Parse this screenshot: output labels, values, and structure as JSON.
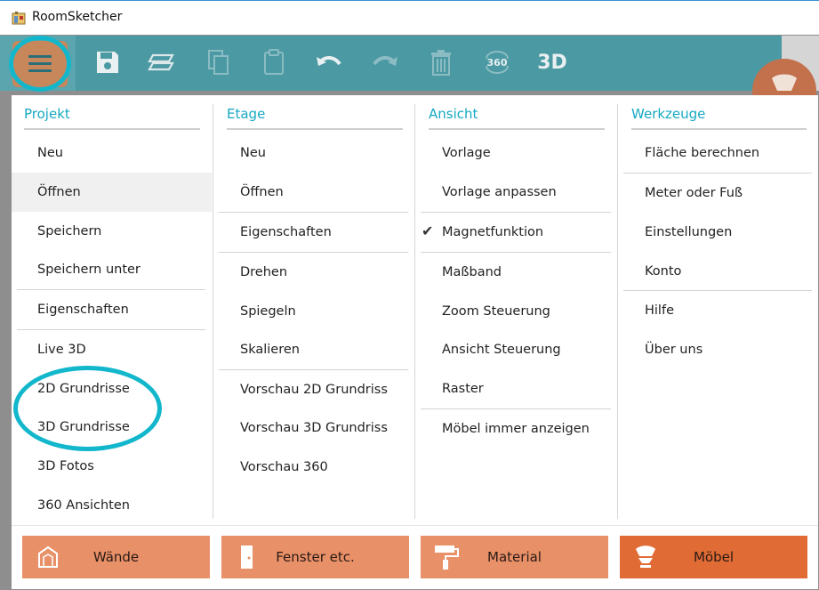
{
  "window": {
    "title": "RoomSketcher"
  },
  "toolbar": {
    "icons": [
      "menu-icon",
      "save-icon",
      "floor-layers-icon",
      "copy-icon",
      "paste-icon",
      "undo-icon",
      "redo-icon",
      "trash-icon",
      "rotate-360-icon"
    ],
    "rotate_label": "360",
    "view_3d_label": "3D"
  },
  "columns": [
    {
      "title": "Projekt",
      "items": [
        "Neu",
        "Öffnen",
        "Speichern",
        "Speichern unter",
        "Eigenschaften",
        "Live 3D",
        "2D Grundrisse",
        "3D Grundrisse",
        "3D Fotos",
        "360 Ansichten"
      ]
    },
    {
      "title": "Etage",
      "items": [
        "Neu",
        "Öffnen",
        "Eigenschaften",
        "Drehen",
        "Spiegeln",
        "Skalieren",
        "Vorschau 2D Grundriss",
        "Vorschau 3D Grundriss",
        "Vorschau 360"
      ]
    },
    {
      "title": "Ansicht",
      "items": [
        "Vorlage",
        "Vorlage anpassen",
        "Magnetfunktion",
        "Maßband",
        "Zoom Steuerung",
        "Ansicht Steuerung",
        "Raster",
        "Möbel immer anzeigen"
      ]
    },
    {
      "title": "Werkzeuge",
      "items": [
        "Fläche berechnen",
        "Meter oder Fuß",
        "Einstellungen",
        "Konto",
        "Hilfe",
        "Über uns"
      ]
    }
  ],
  "checked": {
    "item": "Magnetfunktion",
    "mark": "✔"
  },
  "bottom_buttons": [
    {
      "label": "Wände",
      "icon": "walls-icon"
    },
    {
      "label": "Fenster etc.",
      "icon": "door-icon"
    },
    {
      "label": "Material",
      "icon": "paint-roller-icon"
    },
    {
      "label": "Möbel",
      "icon": "chair-icon",
      "active": true
    }
  ],
  "colors": {
    "accent": "#16a9c2",
    "toolbar": "#4b99a3",
    "bottom_button": "#e89068",
    "bottom_button_active": "#e06b35",
    "highlight": "#12b7cc"
  }
}
